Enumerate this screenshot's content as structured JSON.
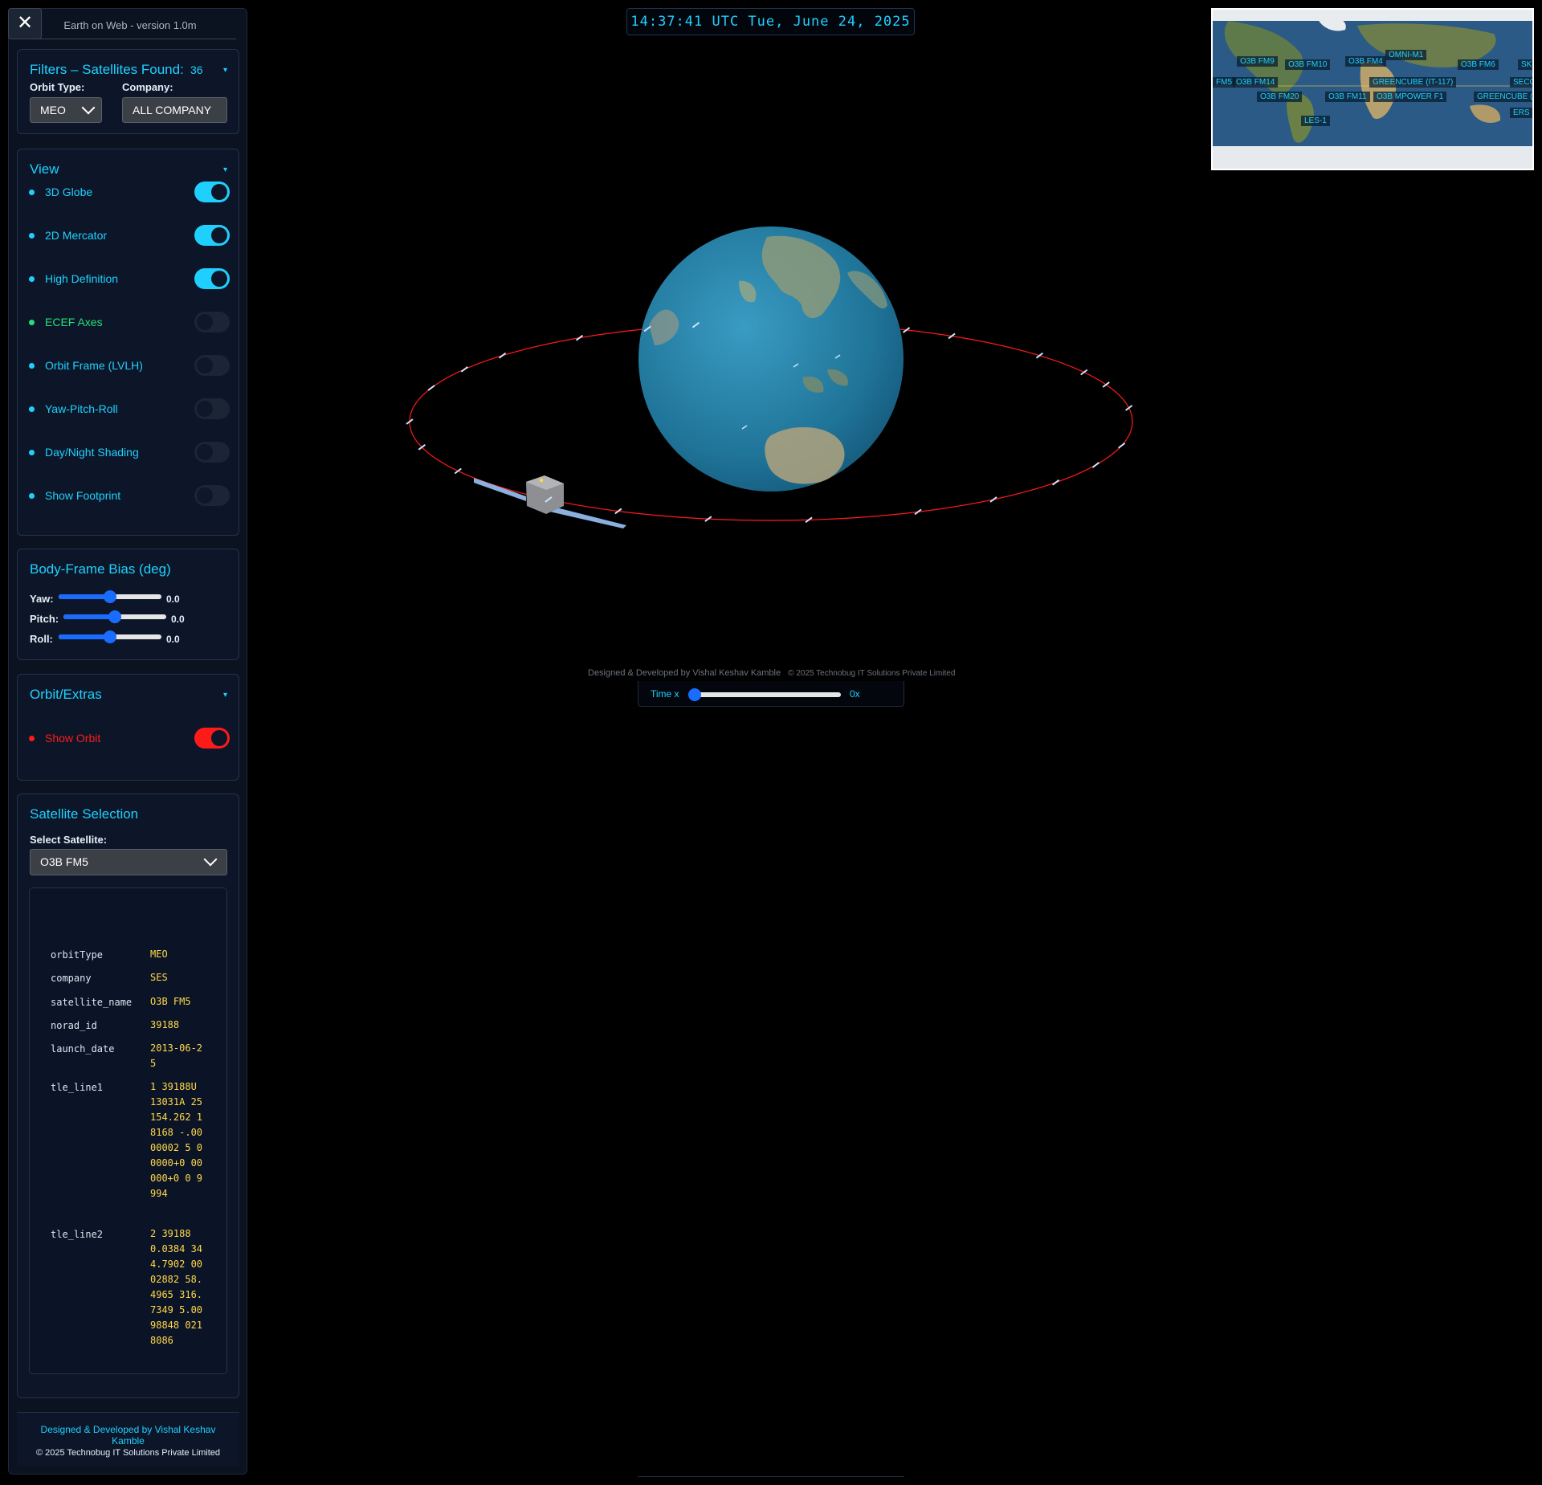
{
  "app": {
    "title": "Earth on Web - version 1.0m",
    "close_glyph": "✕"
  },
  "clock": "14:37:41 UTC Tue, June 24, 2025",
  "filters": {
    "title": "Filters – Satellites Found:",
    "count": "36",
    "orbit_label": "Orbit Type:",
    "orbit_value": "MEO",
    "company_label": "Company:",
    "company_value": "ALL COMPANY"
  },
  "view": {
    "title": "View",
    "items": [
      {
        "label": "3D Globe",
        "on": true,
        "color": "#1fd0ff"
      },
      {
        "label": "2D Mercator",
        "on": true,
        "color": "#1fd0ff"
      },
      {
        "label": "High Definition",
        "on": true,
        "color": "#1fd0ff"
      },
      {
        "label": "ECEF Axes",
        "on": false,
        "color": "#22e07a"
      },
      {
        "label": "Orbit Frame (LVLH)",
        "on": false,
        "color": "#1fd0ff"
      },
      {
        "label": "Yaw-Pitch-Roll",
        "on": false,
        "color": "#1fd0ff"
      },
      {
        "label": "Day/Night Shading",
        "on": false,
        "color": "#1fd0ff"
      },
      {
        "label": "Show Footprint",
        "on": false,
        "color": "#1fd0ff"
      }
    ]
  },
  "bias": {
    "title": "Body-Frame Bias (deg)",
    "yaw_label": "Yaw:",
    "yaw_value": "0.0",
    "pitch_label": "Pitch:",
    "pitch_value": "0.0",
    "roll_label": "Roll:",
    "roll_value": "0.0",
    "slider_fraction": 0.5
  },
  "orbit_extras": {
    "title": "Orbit/Extras",
    "show_orbit_label": "Show Orbit",
    "show_orbit_on": true
  },
  "selection": {
    "title": "Satellite Selection",
    "select_label": "Select Satellite:",
    "selected": "O3B FM5",
    "details": [
      {
        "key": "orbitType",
        "value": "MEO"
      },
      {
        "key": "company",
        "value": "SES"
      },
      {
        "key": "satellite_name",
        "value": "O3B FM5"
      },
      {
        "key": "norad_id",
        "value": "39188"
      },
      {
        "key": "launch_date",
        "value": "2013-06-25"
      },
      {
        "key": "tle_line1",
        "value": "1 39188U 13031A 25154.262 18168 -.0000002 5 00000+0 00000+0 0 9994"
      },
      {
        "key": "tle_line2",
        "value": "2 39188 0.0384 344.7902 0002882 58.4965 316.7349 5.0098848 0218086"
      }
    ]
  },
  "footer": {
    "designed": "Designed & Developed by Vishal Keshav Kamble",
    "copyright": "© 2025 Technobug IT Solutions Private Limited"
  },
  "credit": {
    "designed": "Designed & Developed by Vishal Keshav Kamble",
    "copyright": "© 2025 Technobug IT Solutions Private Limited"
  },
  "time_control": {
    "label": "Time x",
    "value": "0x",
    "fraction": 0.0
  },
  "minimap_labels": [
    "O3B FM9",
    "O3B FM10",
    "O3B FM4",
    "OMNI-M1",
    "O3B FM6",
    "SKY",
    "FM5",
    "O3B FM14",
    "GREENCUBE (IT-117)",
    "SECO",
    "O3B FM20",
    "O3B FM11",
    "O3B MPOWER F1",
    "GREENCUBE (I",
    "ERS",
    "LES-1"
  ],
  "colors": {
    "accent": "#1fd0ff",
    "orbit": "#ff1a1a",
    "tle_value": "#ffd84a",
    "panel": "#0b1220"
  }
}
